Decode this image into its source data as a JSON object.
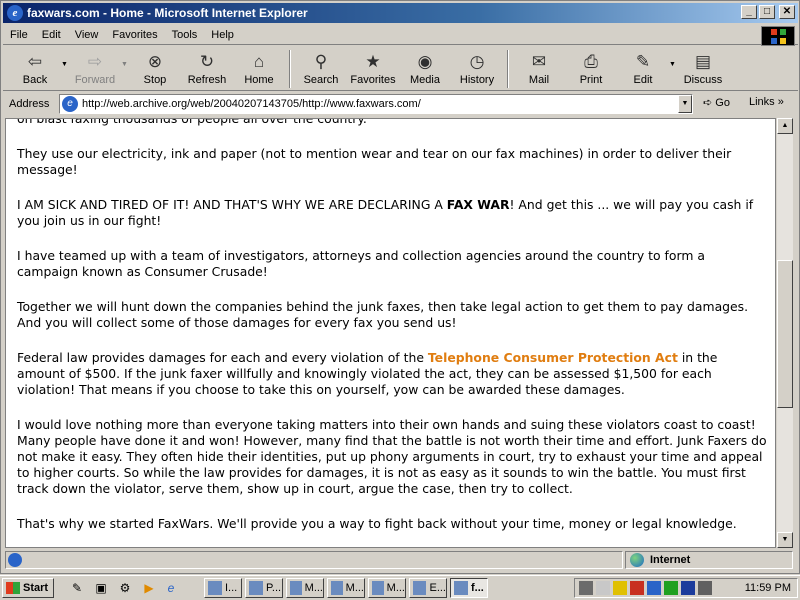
{
  "window": {
    "title": "faxwars.com - Home - Microsoft Internet Explorer",
    "buttons": {
      "minimize": "_",
      "maximize": "□",
      "close": "✕"
    }
  },
  "menu": [
    "File",
    "Edit",
    "View",
    "Favorites",
    "Tools",
    "Help"
  ],
  "toolbar": {
    "back": "Back",
    "forward": "Forward",
    "stop": "Stop",
    "refresh": "Refresh",
    "home": "Home",
    "search": "Search",
    "favorites": "Favorites",
    "media": "Media",
    "history": "History",
    "mail": "Mail",
    "print": "Print",
    "edit": "Edit",
    "discuss": "Discuss"
  },
  "address": {
    "label": "Address",
    "url": "http://web.archive.org/web/20040207143705/http://www.faxwars.com/",
    "go": "Go",
    "links": "Links"
  },
  "content": {
    "p1": "on blast faxing thousands of people all over the country.",
    "p2": "They use our electricity, ink and paper (not to mention wear and tear on our fax machines) in order to deliver their message!",
    "p3_a": "I AM SICK AND TIRED OF IT! AND THAT'S WHY WE ARE DECLARING A ",
    "p3_b": "FAX WAR",
    "p3_c": "! And get this ... we will pay you cash if you join us in our fight!",
    "p4": "I have teamed up with a team of investigators, attorneys and collection agencies around the country to form a campaign known as Consumer Crusade!",
    "p5": "Together we will hunt down the companies behind the junk faxes, then take legal action to get them to pay damages. And you will collect some of those damages for every fax you send us!",
    "p6_a": "Federal law provides damages for each and every violation of the ",
    "p6_link": "Telephone Consumer Protection Act",
    "p6_b": " in the amount of $500. If the junk faxer willfully and knowingly violated the act, they can be assessed $1,500 for each violation! That means if you choose to take this on yourself, yow can be awarded these damages.",
    "p7": "I would love nothing more than everyone taking matters into their own hands and suing these violators coast to coast! Many people have done it and won! However, many find that the battle is not worth their time and effort. Junk Faxers do not make it easy. They often hide their identities, put up phony arguments in court, try to exhaust your time and appeal to higher courts. So while the law provides for damages, it is not as easy as it sounds to win the battle. You must first track down the violator, serve them, show up in court, argue the case, then try to collect.",
    "p8": "That's why we started FaxWars. We'll provide you a way to fight back without your time, money or legal knowledge."
  },
  "status": {
    "zone": "Internet"
  },
  "taskbar": {
    "start": "Start",
    "tasks": [
      "I...",
      "P...",
      "M...",
      "M...",
      "M...",
      "E...",
      "f..."
    ],
    "clock": "11:59 PM"
  },
  "colors": {
    "link": "#e07d10",
    "titlebar": "#0a246a"
  }
}
